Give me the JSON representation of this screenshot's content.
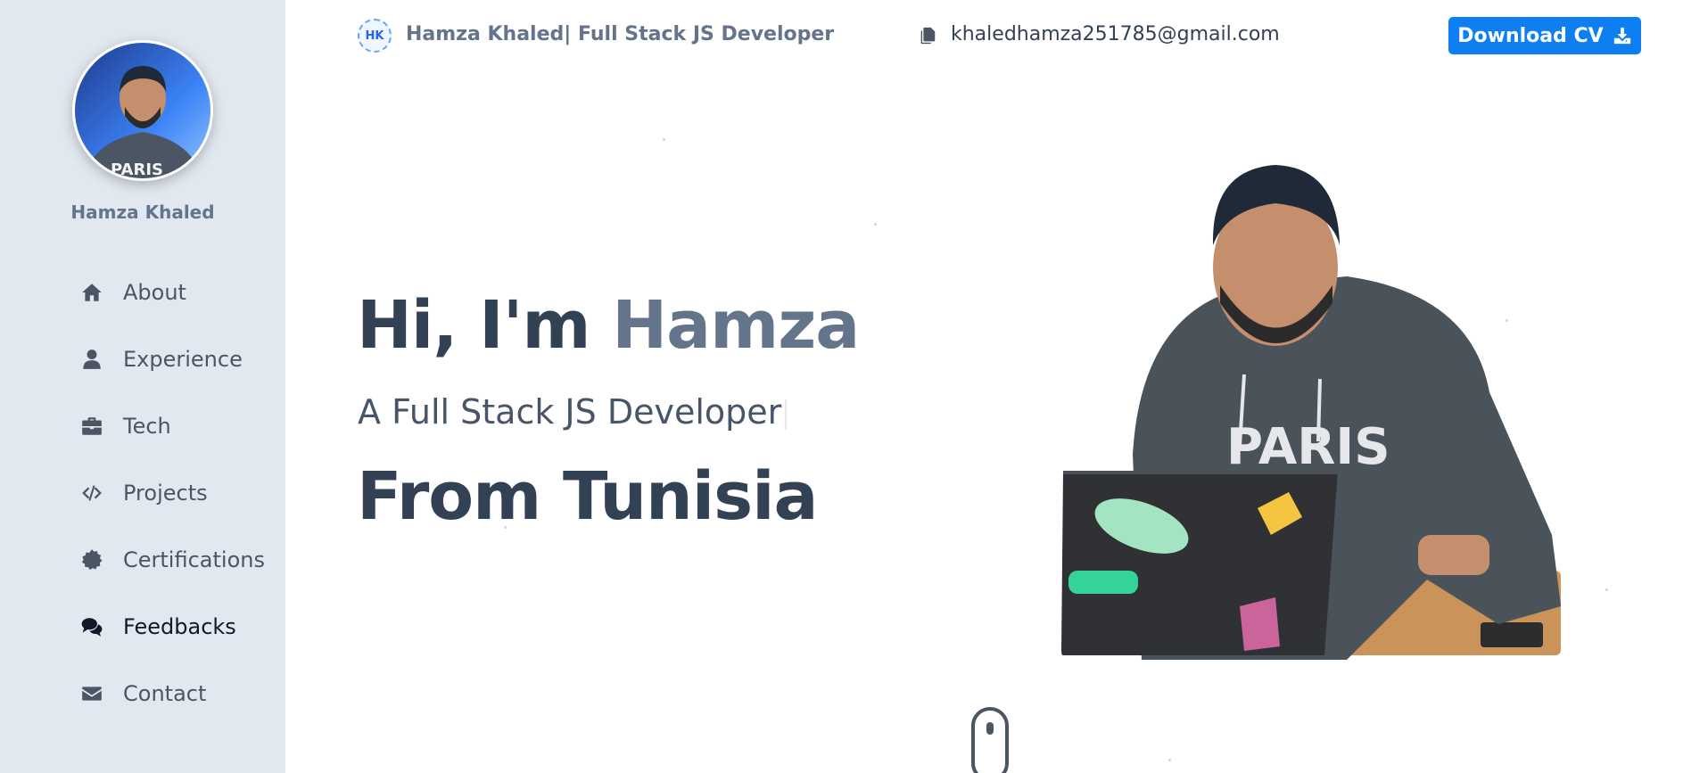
{
  "sidebar": {
    "profile_name": "Hamza Khaled",
    "nav_items": [
      {
        "label": "About",
        "icon": "home-icon"
      },
      {
        "label": "Experience",
        "icon": "user-icon"
      },
      {
        "label": "Tech",
        "icon": "briefcase-icon"
      },
      {
        "label": "Projects",
        "icon": "code-icon"
      },
      {
        "label": "Certifications",
        "icon": "certificate-icon"
      },
      {
        "label": "Feedbacks",
        "icon": "comments-icon",
        "active": true
      },
      {
        "label": "Contact",
        "icon": "envelope-icon"
      }
    ]
  },
  "header": {
    "logo_text": "HK",
    "title": "Hamza Khaled| Full Stack JS Developer",
    "email": "khaledhamza251785@gmail.com",
    "download_label": "Download CV"
  },
  "hero": {
    "greeting": "Hi, I'm ",
    "name": "Hamza",
    "role": "A Full Stack JS Developer",
    "origin": "From Tunisia"
  },
  "colors": {
    "sidebar_bg": "#e2e8f0",
    "accent": "#0d7ff2",
    "heading": "#334155",
    "muted": "#64748b"
  }
}
